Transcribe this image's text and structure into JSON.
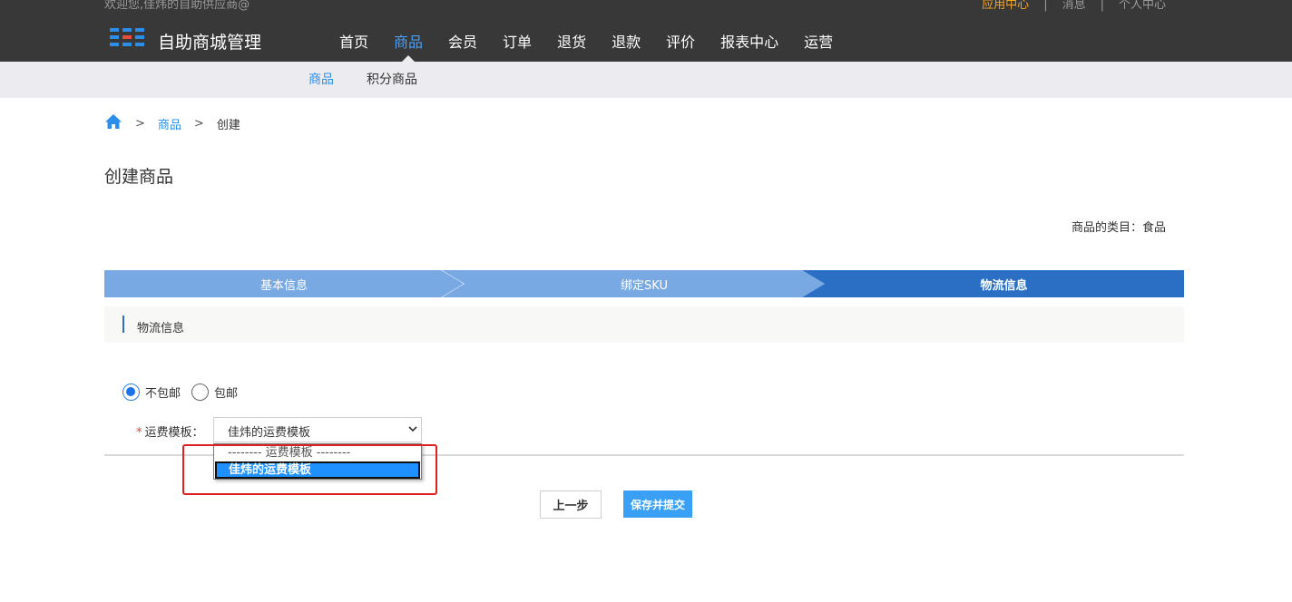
{
  "header": {
    "welcome": "欢迎您,佳炜的自助供应商@",
    "top_links": [
      {
        "label": "应用中心",
        "active": true
      },
      {
        "label": "消息",
        "active": false
      },
      {
        "label": "个人中心",
        "active": false
      }
    ],
    "brand": "自助商城管理",
    "logo_icon": "grid-logo-icon",
    "nav": [
      {
        "label": "首页",
        "active": false
      },
      {
        "label": "商品",
        "active": true
      },
      {
        "label": "会员",
        "active": false
      },
      {
        "label": "订单",
        "active": false
      },
      {
        "label": "退货",
        "active": false
      },
      {
        "label": "退款",
        "active": false
      },
      {
        "label": "评价",
        "active": false
      },
      {
        "label": "报表中心",
        "active": false
      },
      {
        "label": "运营",
        "active": false
      }
    ]
  },
  "sub_nav": [
    {
      "label": "商品",
      "active": true
    },
    {
      "label": "积分商品",
      "active": false
    }
  ],
  "breadcrumb": {
    "home_icon": "home-icon",
    "separator": ">",
    "link": "商品",
    "current": "创建"
  },
  "page_title": "创建商品",
  "category_text": "商品的类目：食品",
  "steps": [
    {
      "label": "基本信息",
      "active": false
    },
    {
      "label": "绑定SKU",
      "active": false
    },
    {
      "label": "物流信息",
      "active": true
    }
  ],
  "section_title": "物流信息",
  "shipping": {
    "options": [
      {
        "label": "不包邮",
        "checked": true
      },
      {
        "label": "包邮",
        "checked": false
      }
    ]
  },
  "template": {
    "required_mark": "*",
    "label": "运费模板：",
    "selected": "佳炜的运费模板",
    "options": [
      {
        "label": "-------- 运费模板 --------",
        "highlighted": false
      },
      {
        "label": "佳炜的运费模板",
        "highlighted": true
      }
    ]
  },
  "buttons": {
    "prev": "上一步",
    "submit": "保存并提交"
  },
  "colors": {
    "header_bg": "#383838",
    "accent": "#2b8ee8",
    "top_link_active": "#f5a623",
    "step_inactive": "#79a9e2",
    "step_active": "#2a6fc4",
    "submit_bg": "#3aa0f5",
    "highlight_border": "#e02020"
  }
}
